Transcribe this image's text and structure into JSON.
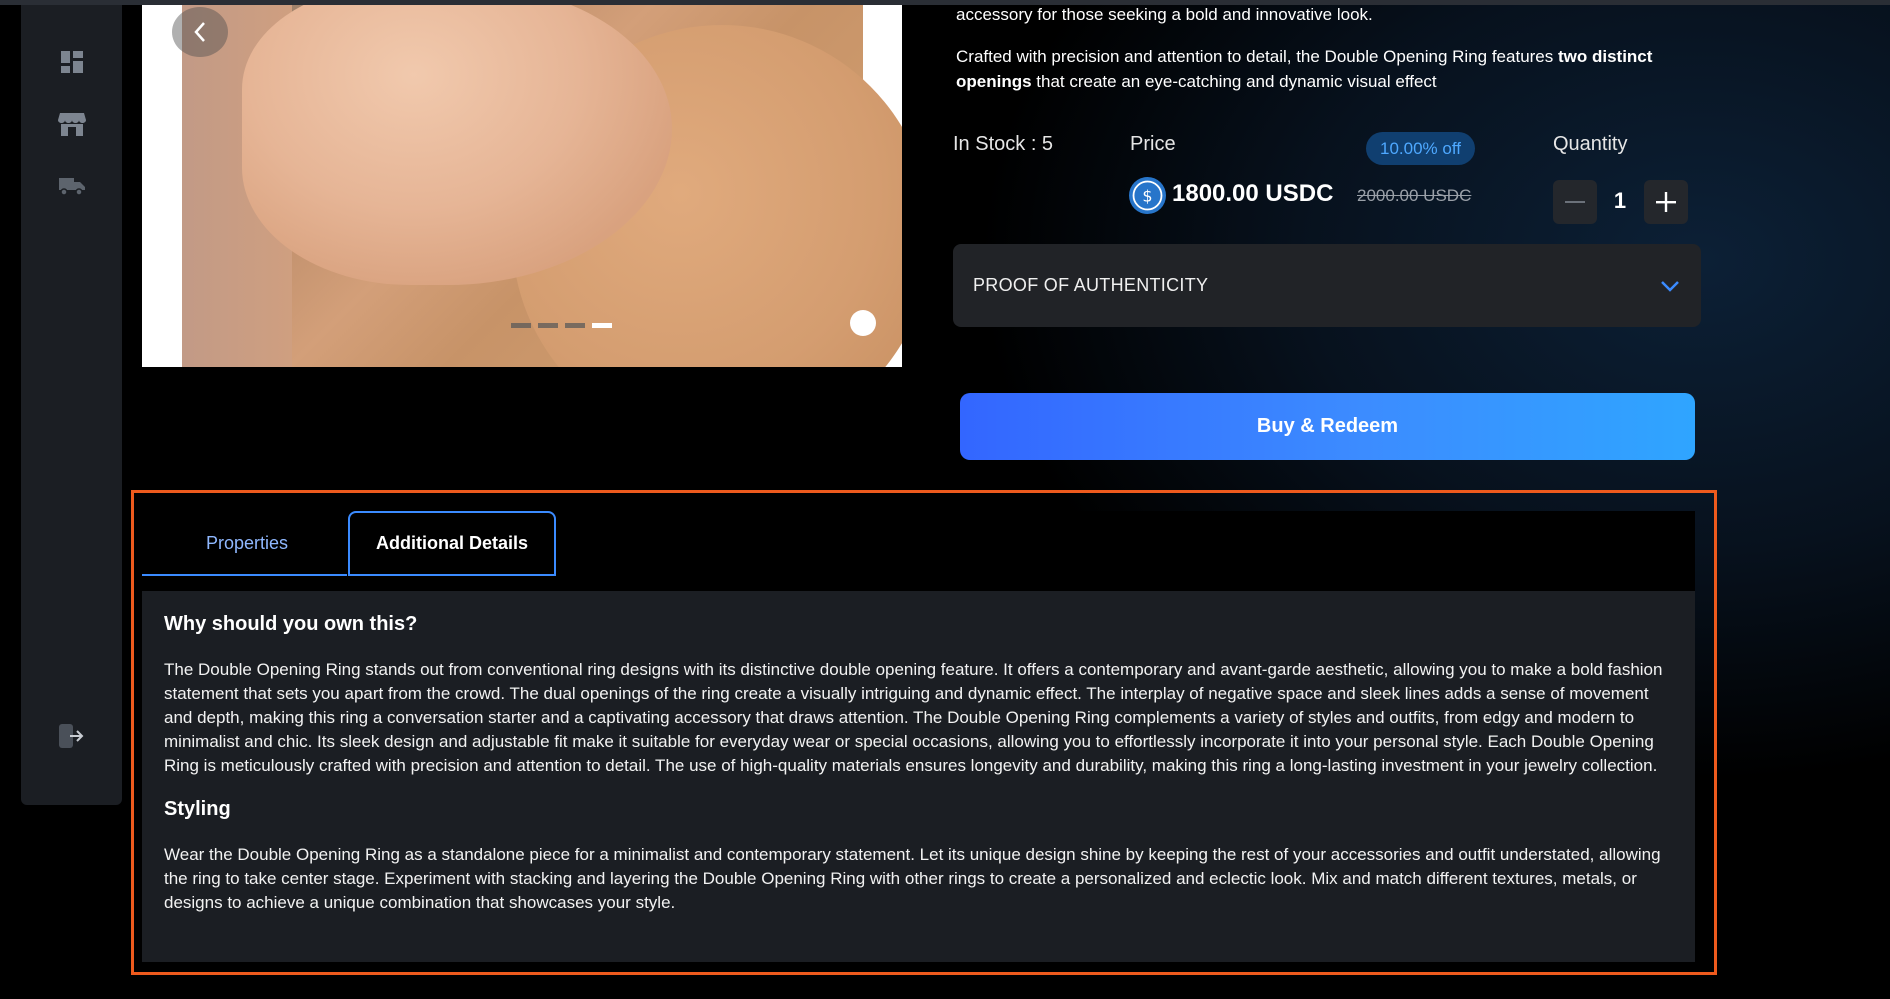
{
  "sidebar": {
    "icons": [
      {
        "name": "dashboard-icon"
      },
      {
        "name": "storefront-icon"
      },
      {
        "name": "delivery-truck-icon"
      }
    ],
    "logout_icon": "logout-icon"
  },
  "gallery": {
    "dots_total": 4,
    "active_dot": 4
  },
  "product": {
    "description_line": "accessory for those seeking a bold and innovative look.",
    "description_para_start": "Crafted with precision and attention to detail, the Double Opening Ring features ",
    "description_para_bold": "two distinct openings",
    "description_para_end": " that create an eye-catching and dynamic visual effect",
    "stock_text": "In Stock : 5",
    "price_label": "Price",
    "discount": "10.00% off",
    "price_current": "1800.00 USDC",
    "price_original": "2000.00 USDC",
    "quantity_label": "Quantity",
    "quantity_value": "1"
  },
  "accordion": {
    "title": "PROOF OF AUTHENTICITY"
  },
  "buy_button": {
    "label": "Buy & Redeem"
  },
  "tabs": {
    "properties": "Properties",
    "additional_details": "Additional Details"
  },
  "details": {
    "heading_why": "Why should you own this?",
    "text_why": "The Double Opening Ring stands out from conventional ring designs with its distinctive double opening feature. It offers a contemporary and avant-garde aesthetic, allowing you to make a bold fashion statement that sets you apart from the crowd. The dual openings of the ring create a visually intriguing and dynamic effect. The interplay of negative space and sleek lines adds a sense of movement and depth, making this ring a conversation starter and a captivating accessory that draws attention. The Double Opening Ring complements a variety of styles and outfits, from edgy and modern to minimalist and chic. Its sleek design and adjustable fit make it suitable for everyday wear or special occasions, allowing you to effortlessly incorporate it into your personal style. Each Double Opening Ring is meticulously crafted with precision and attention to detail. The use of high-quality materials ensures longevity and durability, making this ring a long-lasting investment in your jewelry collection.",
    "heading_styling": "Styling",
    "text_styling": "Wear the Double Opening Ring as a standalone piece for a minimalist and contemporary statement. Let its unique design shine by keeping the rest of your accessories and outfit understated, allowing the ring to take center stage. Experiment with stacking and layering the Double Opening Ring with other rings to create a personalized and eclectic look. Mix and match different textures, metals, or designs to achieve a unique combination that showcases your style."
  },
  "colors": {
    "accent": "#3b8bff",
    "highlight": "#ee5a1d",
    "panel": "#1b1e23",
    "badge_bg": "#103f70"
  }
}
